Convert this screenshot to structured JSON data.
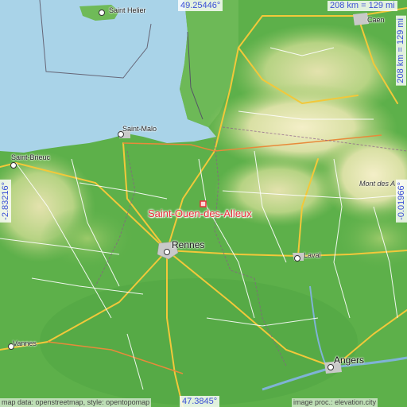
{
  "map": {
    "place_name": "Saint-Ouen-des-Alleux",
    "colors": {
      "sea": "#a9d3e8",
      "lowland": "#5db04a",
      "upland": "#c9d99a",
      "highland": "#efe9c0",
      "road_major": "#f2c83a",
      "road_minor": "#ffffff",
      "place_marker": "#e8303a",
      "coord_text": "#3a4fd6"
    },
    "coords": {
      "top": "49.25446°",
      "bottom": "47.3845°",
      "left": "-2.83216°",
      "right": "-0.01966°"
    },
    "scale": {
      "top": "208 km = 129 mi",
      "right": "208 km = 129 mi"
    },
    "cities": {
      "saint_helier": "Saint Helier",
      "saint_malo": "Saint-Malo",
      "saint_brieuc": "Saint-Brieuc",
      "rennes": "Rennes",
      "laval": "Laval",
      "vannes": "Vannes",
      "angers": "Angers",
      "mont_des_avaloirs": "Mont des A",
      "caen_partial": "Caen"
    },
    "credits": {
      "left": "map data: openstreetmap, style: opentopomap",
      "right": "image proc.: elevation.city"
    }
  }
}
